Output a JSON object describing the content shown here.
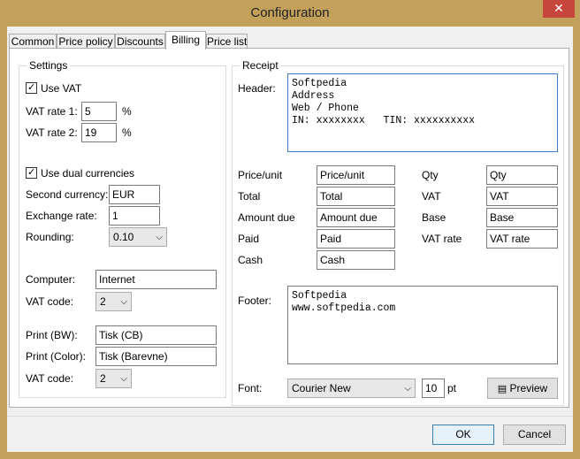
{
  "window": {
    "title": "Configuration",
    "close_glyph": "✕"
  },
  "tabs": [
    {
      "label": "Common"
    },
    {
      "label": "Price policy"
    },
    {
      "label": "Discounts"
    },
    {
      "label": "Billing"
    },
    {
      "label": "Price list"
    }
  ],
  "settings": {
    "title": "Settings",
    "use_vat": {
      "label": "Use VAT",
      "checked": true
    },
    "vat_rate1": {
      "label": "VAT rate 1:",
      "value": "5",
      "unit": "%"
    },
    "vat_rate2": {
      "label": "VAT rate 2:",
      "value": "19",
      "unit": "%"
    },
    "use_dual": {
      "label": "Use dual currencies",
      "checked": true
    },
    "second_currency": {
      "label": "Second currency:",
      "value": "EUR"
    },
    "exchange_rate": {
      "label": "Exchange rate:",
      "value": "1"
    },
    "rounding": {
      "label": "Rounding:",
      "value": "0.10"
    },
    "computer": {
      "label": "Computer:",
      "value": "Internet"
    },
    "vat_code1": {
      "label": "VAT code:",
      "value": "2"
    },
    "print_bw": {
      "label": "Print (BW):",
      "value": "Tisk (CB)"
    },
    "print_color": {
      "label": "Print (Color):",
      "value": "Tisk (Barevne)"
    },
    "vat_code2": {
      "label": "VAT code:",
      "value": "2"
    }
  },
  "receipt": {
    "title": "Receipt",
    "header_label": "Header:",
    "header_lines": [
      "Softpedia",
      "Address",
      "Web / Phone",
      "IN: xxxxxxxx   TIN: xxxxxxxxxx"
    ],
    "fields_left": [
      {
        "label": "Price/unit",
        "value": "Price/unit"
      },
      {
        "label": "Total",
        "value": "Total"
      },
      {
        "label": "Amount due",
        "value": "Amount due"
      },
      {
        "label": "Paid",
        "value": "Paid"
      },
      {
        "label": "Cash",
        "value": "Cash"
      }
    ],
    "fields_right": [
      {
        "label": "Qty",
        "value": "Qty"
      },
      {
        "label": "VAT",
        "value": "VAT"
      },
      {
        "label": "Base",
        "value": "Base"
      },
      {
        "label": "VAT rate",
        "value": "VAT rate"
      }
    ],
    "footer_label": "Footer:",
    "footer_lines": [
      "Softpedia",
      "www.softpedia.com"
    ],
    "font_label": "Font:",
    "font_value": "Courier New",
    "font_size": "10",
    "font_unit": "pt",
    "preview_label": "Preview"
  },
  "buttons": {
    "ok": "OK",
    "cancel": "Cancel"
  }
}
